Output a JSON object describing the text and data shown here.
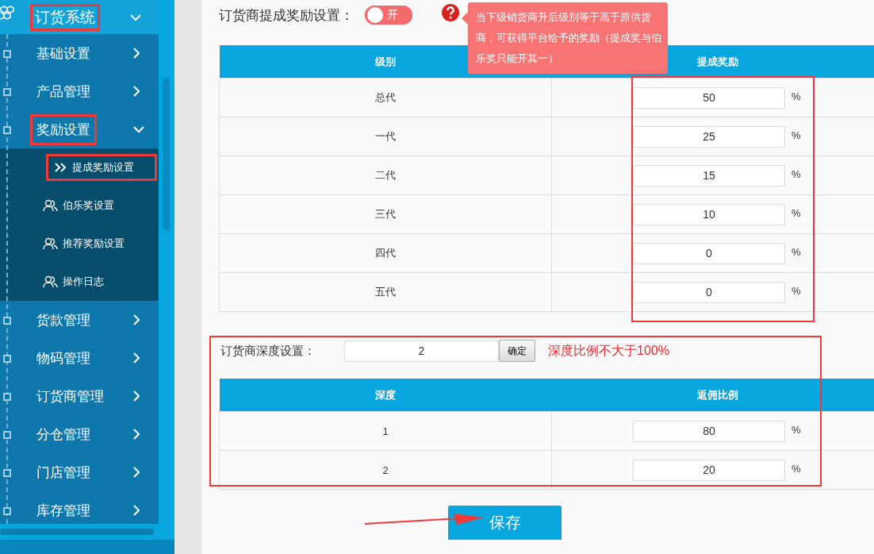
{
  "sidebar": {
    "header": {
      "label": "订货系统",
      "expanded": true,
      "highlighted": true
    },
    "items": [
      {
        "label": "基础设置",
        "expanded": false,
        "highlighted": false
      },
      {
        "label": "产品管理",
        "expanded": false,
        "highlighted": false
      },
      {
        "label": "奖励设置",
        "expanded": true,
        "highlighted": true,
        "children": [
          {
            "label": "提成奖励设置",
            "selected": true,
            "highlighted": true
          },
          {
            "label": "伯乐奖设置",
            "selected": false,
            "highlighted": false
          },
          {
            "label": "推荐奖励设置",
            "selected": false,
            "highlighted": false
          },
          {
            "label": "操作日志",
            "selected": false,
            "highlighted": false
          }
        ]
      },
      {
        "label": "货款管理",
        "expanded": false,
        "highlighted": false
      },
      {
        "label": "物码管理",
        "expanded": false,
        "highlighted": false
      },
      {
        "label": "订货商管理",
        "expanded": false,
        "highlighted": false
      },
      {
        "label": "分仓管理",
        "expanded": false,
        "highlighted": false
      },
      {
        "label": "门店管理",
        "expanded": false,
        "highlighted": false
      },
      {
        "label": "库存管理",
        "expanded": false,
        "highlighted": false
      }
    ]
  },
  "commission": {
    "label": "订货商提成奖励设置：",
    "toggle": {
      "on": true,
      "label": "开"
    },
    "tooltip": "当下级销货商升后级别等于高于原供货商，可获得平台给予的奖励（提成奖与伯乐奖只能开其一）",
    "highlighted": true,
    "table": {
      "columns": [
        "级别",
        "提成奖励"
      ],
      "rows": [
        {
          "name": "总代",
          "value": "50",
          "unit": "%"
        },
        {
          "name": "一代",
          "value": "25",
          "unit": "%"
        },
        {
          "name": "二代",
          "value": "15",
          "unit": "%"
        },
        {
          "name": "三代",
          "value": "10",
          "unit": "%"
        },
        {
          "name": "四代",
          "value": "0",
          "unit": "%"
        },
        {
          "name": "五代",
          "value": "0",
          "unit": "%"
        }
      ]
    }
  },
  "depth": {
    "label": "订货商深度设置：",
    "value": "2",
    "confirm": "确定",
    "warning": "深度比例不大于100%",
    "highlighted": true,
    "table": {
      "columns": [
        "深度",
        "返佣比例"
      ],
      "rows": [
        {
          "name": "1",
          "value": "80",
          "unit": "%"
        },
        {
          "name": "2",
          "value": "20",
          "unit": "%"
        }
      ]
    }
  },
  "save": {
    "label": "保存",
    "pointed_at": true
  }
}
